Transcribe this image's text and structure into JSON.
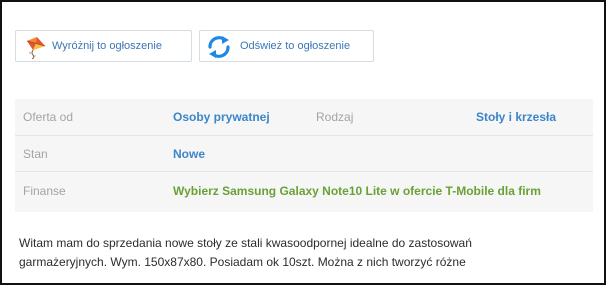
{
  "actions": {
    "highlight_label": "Wyróżnij to ogłoszenie",
    "refresh_label": "Odśwież to ogłoszenie"
  },
  "details": {
    "offer_from_key": "Oferta od",
    "offer_from_value": "Osoby prywatnej",
    "type_key": "Rodzaj",
    "type_value": "Stoły i krzesła",
    "condition_key": "Stan",
    "condition_value": "Nowe",
    "finance_key": "Finanse",
    "finance_value": "Wybierz Samsung Galaxy Note10 Lite w ofercie T-Mobile dla firm"
  },
  "description": {
    "line1": "Witam mam do sprzedania nowe stoły ze stali kwasoodpornej idealne do zastosowań",
    "line2": "garmażeryjnych. Wym. 150x87x80. Posiadam ok 10szt. Można z nich tworzyć różne"
  },
  "colors": {
    "link_blue": "#3b86c8",
    "finance_green": "#68a236",
    "label_gray": "#a4a4a4",
    "panel_bg": "#f6f6f6",
    "refresh_icon": "#1e88e5"
  },
  "icons": {
    "highlight": "kite-icon",
    "refresh": "refresh-icon"
  }
}
